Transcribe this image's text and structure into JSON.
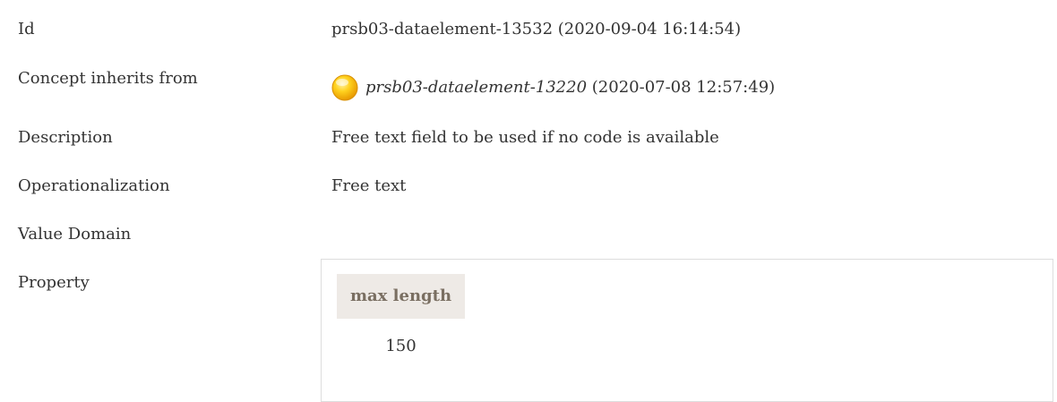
{
  "rows": [
    {
      "label": "Id",
      "value": "prsb03-dataelement-13532 (2020-09-04 16:14:54)"
    },
    {
      "label": "Concept inherits from",
      "concept_id": "prsb03-dataelement-13220",
      "concept_date": "(2020-07-08 12:57:49)",
      "icon": "yellow-circle-icon"
    },
    {
      "label": "Description",
      "value": "Free text field to be used if no code is available"
    },
    {
      "label": "Operationalization",
      "value": "Free text"
    },
    {
      "label": "Value Domain"
    },
    {
      "label": "Property"
    }
  ],
  "property_table": {
    "header": "max length",
    "value": "150"
  },
  "colors": {
    "text": "#333333",
    "header_bg": "#eeeae6",
    "header_text": "#7a6f62",
    "border": "#dddddd",
    "icon_fill": "#ffc800"
  }
}
